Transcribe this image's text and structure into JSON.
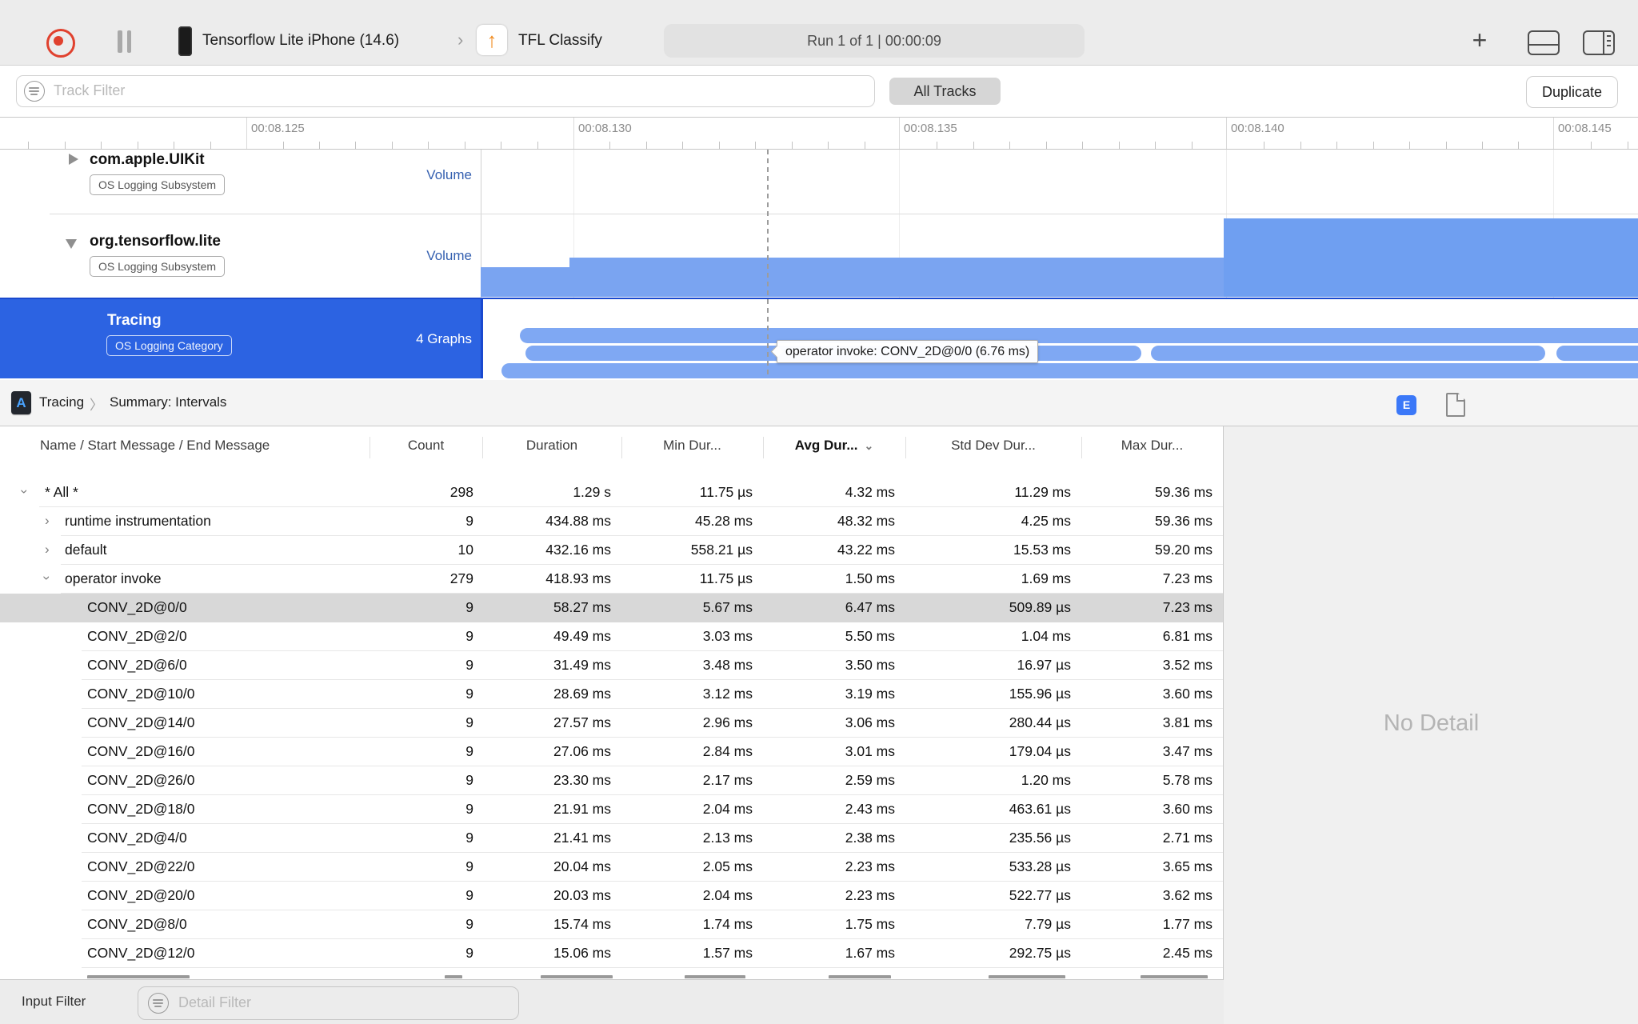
{
  "toolbar": {
    "device": "Tensorflow Lite iPhone (14.6)",
    "crumb_sep": "›",
    "target": "TFL Classify",
    "tfl_glyph": "↑",
    "run_info": "Run 1 of 1  |  00:00:09",
    "plus": "+"
  },
  "filter_bar": {
    "track_filter_placeholder": "Track Filter",
    "all_tracks_label": "All Tracks",
    "duplicate_label": "Duplicate"
  },
  "ruler": {
    "labels": [
      "00:08.125",
      "00:08.130",
      "00:08.135",
      "00:08.140",
      "00:08.145"
    ]
  },
  "tracks": [
    {
      "title": "com.apple.UIKit",
      "badge": "OS Logging Subsystem",
      "meta": "Volume"
    },
    {
      "title": "org.tensorflow.lite",
      "badge": "OS Logging Subsystem",
      "meta": "Volume"
    },
    {
      "title": "Tracing",
      "badge": "OS Logging Category",
      "meta": "4 Graphs"
    }
  ],
  "tooltip_text": "operator invoke: CONV_2D@0/0 (6.76 ms)",
  "breadcrumb": {
    "icon": "A",
    "first": "Tracing",
    "sep": "〉",
    "second": "Summary: Intervals"
  },
  "detail_panel": {
    "e_badge": "E",
    "no_detail": "No Detail"
  },
  "table": {
    "headers": {
      "name": "Name / Start Message / End Message",
      "count": "Count",
      "duration": "Duration",
      "min": "Min Dur...",
      "avg": "Avg Dur...",
      "avg_sort_chevron": "⌄",
      "std": "Std Dev Dur...",
      "max": "Max Dur..."
    },
    "rows": [
      {
        "name": "* All *",
        "count": "298",
        "duration": "1.29 s",
        "min": "11.75 µs",
        "avg": "4.32 ms",
        "std": "11.29 ms",
        "max": "59.36 ms",
        "level": 0,
        "twisty": "open",
        "selected": false
      },
      {
        "name": "runtime instrumentation",
        "count": "9",
        "duration": "434.88 ms",
        "min": "45.28 ms",
        "avg": "48.32 ms",
        "std": "4.25 ms",
        "max": "59.36 ms",
        "level": 1,
        "twisty": "closed",
        "selected": false
      },
      {
        "name": "default",
        "count": "10",
        "duration": "432.16 ms",
        "min": "558.21 µs",
        "avg": "43.22 ms",
        "std": "15.53 ms",
        "max": "59.20 ms",
        "level": 1,
        "twisty": "closed",
        "selected": false
      },
      {
        "name": "operator invoke",
        "count": "279",
        "duration": "418.93 ms",
        "min": "11.75 µs",
        "avg": "1.50 ms",
        "std": "1.69 ms",
        "max": "7.23 ms",
        "level": 1,
        "twisty": "open",
        "selected": false
      },
      {
        "name": "CONV_2D@0/0",
        "count": "9",
        "duration": "58.27 ms",
        "min": "5.67 ms",
        "avg": "6.47 ms",
        "std": "509.89 µs",
        "max": "7.23 ms",
        "level": 2,
        "twisty": "",
        "selected": true
      },
      {
        "name": "CONV_2D@2/0",
        "count": "9",
        "duration": "49.49 ms",
        "min": "3.03 ms",
        "avg": "5.50 ms",
        "std": "1.04 ms",
        "max": "6.81 ms",
        "level": 2,
        "twisty": "",
        "selected": false
      },
      {
        "name": "CONV_2D@6/0",
        "count": "9",
        "duration": "31.49 ms",
        "min": "3.48 ms",
        "avg": "3.50 ms",
        "std": "16.97 µs",
        "max": "3.52 ms",
        "level": 2,
        "twisty": "",
        "selected": false
      },
      {
        "name": "CONV_2D@10/0",
        "count": "9",
        "duration": "28.69 ms",
        "min": "3.12 ms",
        "avg": "3.19 ms",
        "std": "155.96 µs",
        "max": "3.60 ms",
        "level": 2,
        "twisty": "",
        "selected": false
      },
      {
        "name": "CONV_2D@14/0",
        "count": "9",
        "duration": "27.57 ms",
        "min": "2.96 ms",
        "avg": "3.06 ms",
        "std": "280.44 µs",
        "max": "3.81 ms",
        "level": 2,
        "twisty": "",
        "selected": false
      },
      {
        "name": "CONV_2D@16/0",
        "count": "9",
        "duration": "27.06 ms",
        "min": "2.84 ms",
        "avg": "3.01 ms",
        "std": "179.04 µs",
        "max": "3.47 ms",
        "level": 2,
        "twisty": "",
        "selected": false
      },
      {
        "name": "CONV_2D@26/0",
        "count": "9",
        "duration": "23.30 ms",
        "min": "2.17 ms",
        "avg": "2.59 ms",
        "std": "1.20 ms",
        "max": "5.78 ms",
        "level": 2,
        "twisty": "",
        "selected": false
      },
      {
        "name": "CONV_2D@18/0",
        "count": "9",
        "duration": "21.91 ms",
        "min": "2.04 ms",
        "avg": "2.43 ms",
        "std": "463.61 µs",
        "max": "3.60 ms",
        "level": 2,
        "twisty": "",
        "selected": false
      },
      {
        "name": "CONV_2D@4/0",
        "count": "9",
        "duration": "21.41 ms",
        "min": "2.13 ms",
        "avg": "2.38 ms",
        "std": "235.56 µs",
        "max": "2.71 ms",
        "level": 2,
        "twisty": "",
        "selected": false
      },
      {
        "name": "CONV_2D@22/0",
        "count": "9",
        "duration": "20.04 ms",
        "min": "2.05 ms",
        "avg": "2.23 ms",
        "std": "533.28 µs",
        "max": "3.65 ms",
        "level": 2,
        "twisty": "",
        "selected": false
      },
      {
        "name": "CONV_2D@20/0",
        "count": "9",
        "duration": "20.03 ms",
        "min": "2.04 ms",
        "avg": "2.23 ms",
        "std": "522.77 µs",
        "max": "3.62 ms",
        "level": 2,
        "twisty": "",
        "selected": false
      },
      {
        "name": "CONV_2D@8/0",
        "count": "9",
        "duration": "15.74 ms",
        "min": "1.74 ms",
        "avg": "1.75 ms",
        "std": "7.79 µs",
        "max": "1.77 ms",
        "level": 2,
        "twisty": "",
        "selected": false
      },
      {
        "name": "CONV_2D@12/0",
        "count": "9",
        "duration": "15.06 ms",
        "min": "1.57 ms",
        "avg": "1.67 ms",
        "std": "292.75 µs",
        "max": "2.45 ms",
        "level": 2,
        "twisty": "",
        "selected": false
      }
    ]
  },
  "bottom_bar": {
    "label": "Input Filter",
    "detail_filter_placeholder": "Detail Filter"
  },
  "colors": {
    "selection_blue": "#2c63e2",
    "lane_blue": "#7fa8f3",
    "histogram_blue": "#7aa4f1",
    "record_red": "#e0412e",
    "tfl_orange": "#f08a1d",
    "e_badge_blue": "#3b78f8"
  }
}
